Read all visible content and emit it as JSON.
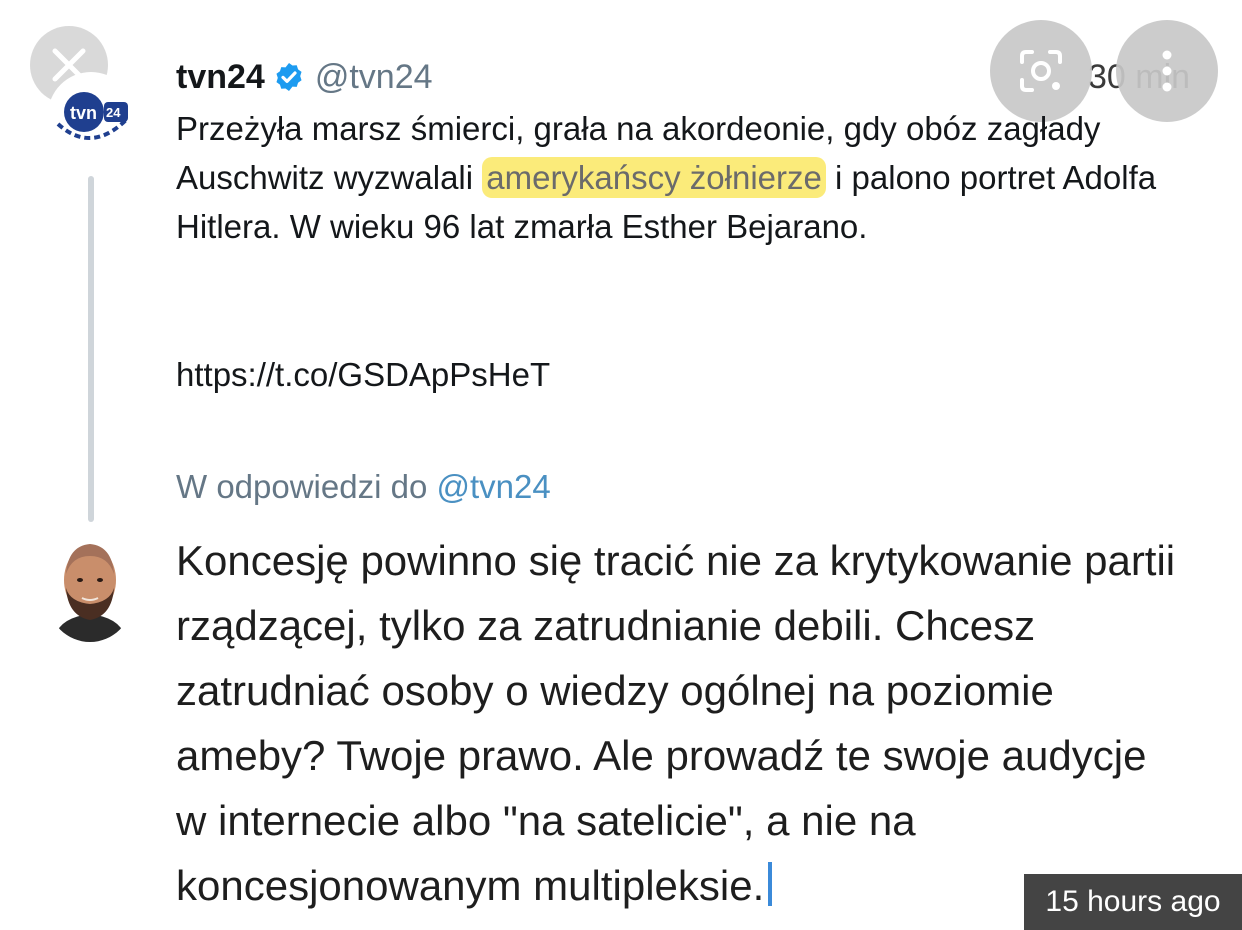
{
  "tweet": {
    "author": "tvn24",
    "handle": "@tvn24",
    "time": "30 min",
    "text_before": "Przeżyła marsz śmierci, grała na akordeonie, gdy obóz zagłady Auschwitz wyzwalali ",
    "text_highlight": "amerykańscy żołnierze",
    "text_after": " i palono portret Adolfa Hitlera. W wieku 96 lat zmarła Esther Bejarano.",
    "link": "https://t.co/GSDApPsHeT",
    "avatar_logo": "tvn24"
  },
  "reply": {
    "in_reply_prefix": "W odpowiedzi do ",
    "in_reply_mention": "@tvn24",
    "text": "Koncesję powinno się tracić nie za krytykowanie partii rządzącej, tylko za zatrudnianie debili. Chcesz zatrudniać osoby o wiedzy ogólnej na poziomie ameby? Twoje prawo. Ale prowadź te swoje audycje w internecie albo \"na satelicie\", a nie na koncesjonowanym multipleksie."
  },
  "overlay": {
    "timestamp": "15 hours ago"
  },
  "icons": {
    "close": "close-icon",
    "lens": "lens-icon",
    "more": "more-vertical-icon",
    "verified": "verified-badge-icon"
  },
  "colors": {
    "highlight": "#fbeb7a",
    "handle": "#657786",
    "mention": "#4a90c2",
    "verified": "#1d9bf0",
    "tvn_blue": "#1f3f8f"
  }
}
